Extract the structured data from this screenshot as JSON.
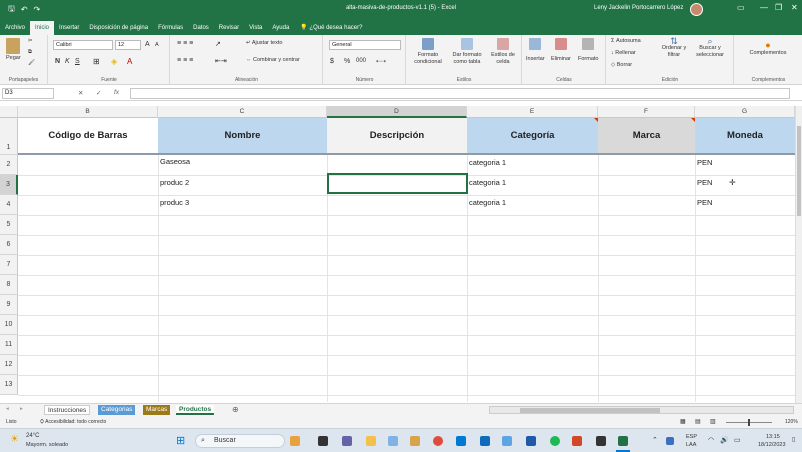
{
  "titlebar": {
    "doc_title": "alta-masiva-de-productos-v1.1 (5) - Excel",
    "user_name": "Leny Jackelin Portocarrero López",
    "minimize": "—",
    "restore": "❐",
    "close": "✕"
  },
  "ribbon_tabs": [
    "Archivo",
    "Inicio",
    "Insertar",
    "Disposición de página",
    "Fórmulas",
    "Datos",
    "Revisar",
    "Vista",
    "Ayuda"
  ],
  "tell_me": "¿Qué desea hacer?",
  "ribbon": {
    "clipboard": {
      "paste": "Pegar",
      "label": "Portapapeles"
    },
    "font": {
      "name": "Calibri",
      "size": "12",
      "label": "Fuente",
      "bold": "N",
      "italic": "K",
      "underline": "S",
      "grow": "A",
      "shrink": "A"
    },
    "alignment": {
      "wrap": "Ajustar texto",
      "merge": "Combinar y centrar",
      "label": "Alineación"
    },
    "number": {
      "format": "General",
      "currency": "$",
      "percent": "%",
      "comma": "000",
      "label": "Número"
    },
    "styles": {
      "conditional": "Formato condicional",
      "table": "Dar formato como tabla",
      "cell": "Estilos de celda",
      "label": "Estilos"
    },
    "cells": {
      "insert": "Insertar",
      "delete": "Eliminar",
      "format": "Formato",
      "label": "Celdas"
    },
    "editing": {
      "autosum": "Autosuma",
      "fill": "Rellenar",
      "clear": "Borrar",
      "sort": "Ordenar y filtrar",
      "find": "Buscar y seleccionar",
      "label": "Edición"
    },
    "addins": {
      "complements": "Complementos",
      "label": "Complementos"
    }
  },
  "formula_bar": {
    "name_box": "D3",
    "fx": "fx",
    "cancel": "✕",
    "enter": "✓",
    "value": ""
  },
  "grid": {
    "columns": [
      "B",
      "C",
      "D",
      "E",
      "F",
      "G"
    ],
    "selected_column": "D",
    "rows": [
      "1",
      "2",
      "3",
      "4",
      "5",
      "6",
      "7",
      "8",
      "9",
      "10",
      "11",
      "12",
      "13"
    ],
    "selected_row": "3",
    "headers": [
      "Código de Barras",
      "Nombre",
      "Descripción",
      "Categoría",
      "Marca",
      "Moneda"
    ],
    "data": [
      {
        "nombre": "Gaseosa",
        "categoria": "categoria 1",
        "moneda": "PEN"
      },
      {
        "nombre": "produc 2",
        "categoria": "categoria 1",
        "moneda": "PEN"
      },
      {
        "nombre": "produc 3",
        "categoria": "categoria 1",
        "moneda": "PEN"
      }
    ]
  },
  "sheets": [
    {
      "name": "Instrucciones",
      "color": "#ffffff",
      "text": "#333333"
    },
    {
      "name": "Categorias",
      "color": "#5b9bd5",
      "text": "#ffffff"
    },
    {
      "name": "Marcas",
      "color": "#9c7a17",
      "text": "#ffffff"
    },
    {
      "name": "Productos",
      "color": "#ffffff",
      "text": "#217346"
    }
  ],
  "status": {
    "mode": "Listo",
    "accessibility": "Accesibilidad: todo correcto",
    "zoom": "120%"
  },
  "taskbar": {
    "weather_temp": "24°C",
    "weather_desc": "Mayorm. soleado",
    "search": "Buscar",
    "lang1": "ESP",
    "lang2": "LAA",
    "time": "13:15",
    "date": "18/12/2023"
  }
}
